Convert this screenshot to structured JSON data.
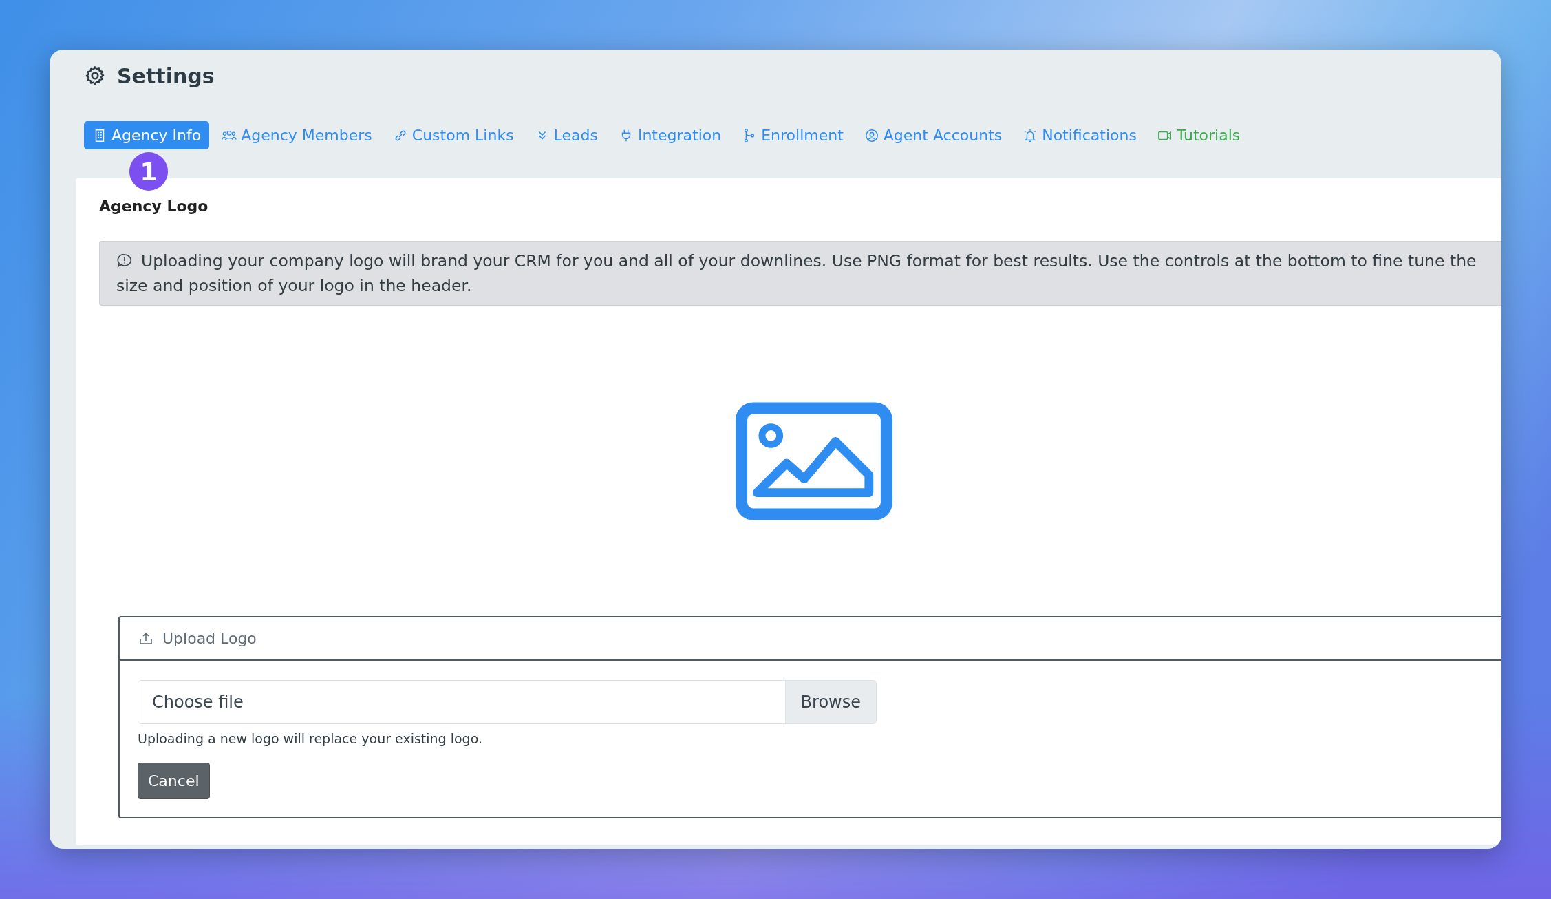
{
  "window": {
    "title": "Settings"
  },
  "tabs": [
    {
      "label": "Agency Info",
      "color": "#2f8cf0",
      "selected": true
    },
    {
      "label": "Agency Members",
      "color": "#2f8cf0",
      "selected": false
    },
    {
      "label": "Custom Links",
      "color": "#2f8cf0",
      "selected": false
    },
    {
      "label": "Leads",
      "color": "#2f8cf0",
      "selected": false
    },
    {
      "label": "Integration",
      "color": "#2f8cf0",
      "selected": false
    },
    {
      "label": "Enrollment",
      "color": "#2f8cf0",
      "selected": false
    },
    {
      "label": "Agent Accounts",
      "color": "#2f8cf0",
      "selected": false
    },
    {
      "label": "Notifications",
      "color": "#2f8cf0",
      "selected": false
    },
    {
      "label": "Tutorials",
      "color": "#3daa4f",
      "selected": false
    }
  ],
  "step_badge": "1",
  "section": {
    "title": "Agency Logo",
    "notice_lines": [
      "Uploading your company logo will brand your CRM for you and all of your downlines. Use PNG format for best results. Use the controls at the bottom to fine tune the",
      "size and position of your logo in the header."
    ],
    "upload": {
      "title": "Upload Logo",
      "file_field": {
        "placeholder": "Choose file",
        "button": "Browse"
      },
      "help": "Uploading a new logo will replace your existing logo.",
      "cancel": "Cancel"
    }
  }
}
